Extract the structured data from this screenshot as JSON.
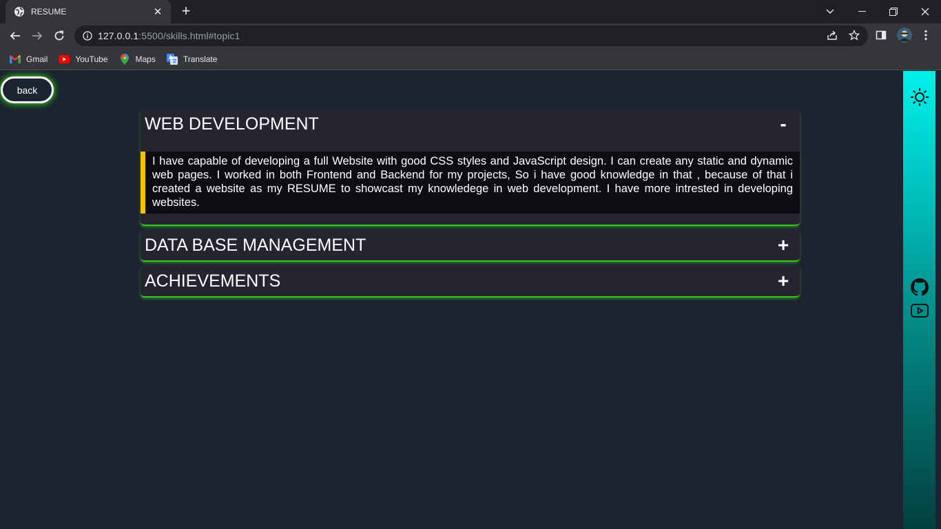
{
  "browser": {
    "tab": {
      "title": "RESUME"
    },
    "address": {
      "host": "127.0.0.1",
      "rest": ":5500/skills.html#topic1"
    },
    "bookmarks": [
      {
        "label": "Gmail",
        "icon": "gmail-icon"
      },
      {
        "label": "YouTube",
        "icon": "youtube-icon"
      },
      {
        "label": "Maps",
        "icon": "maps-icon"
      },
      {
        "label": "Translate",
        "icon": "translate-icon"
      }
    ]
  },
  "page": {
    "back_label": "back",
    "sections": [
      {
        "title": "WEB DEVELOPMENT",
        "toggle": "-",
        "expanded": true,
        "body": "I have capable of developing a full Website with good CSS styles and JavaScript design. I can create any static and dynamic web pages. I worked in both Frontend and Backend for my projects, So i have good knowledge in that , because of that i created a website as my RESUME to showcast my knowledege in web development. I have more intrested in developing websites."
      },
      {
        "title": "DATA BASE MANAGEMENT",
        "toggle": "+",
        "expanded": false
      },
      {
        "title": "ACHIEVEMENTS",
        "toggle": "+",
        "expanded": false
      }
    ],
    "sidebar_icons": [
      "sun-icon",
      "github-icon",
      "youtube-icon"
    ]
  },
  "colors": {
    "page_bg": "#1b2430",
    "card_bg": "#252531",
    "glow_green": "#3ac521",
    "body_accent": "#f5c400",
    "sidebar_top": "#00f0ea",
    "sidebar_bottom": "#02403f"
  }
}
